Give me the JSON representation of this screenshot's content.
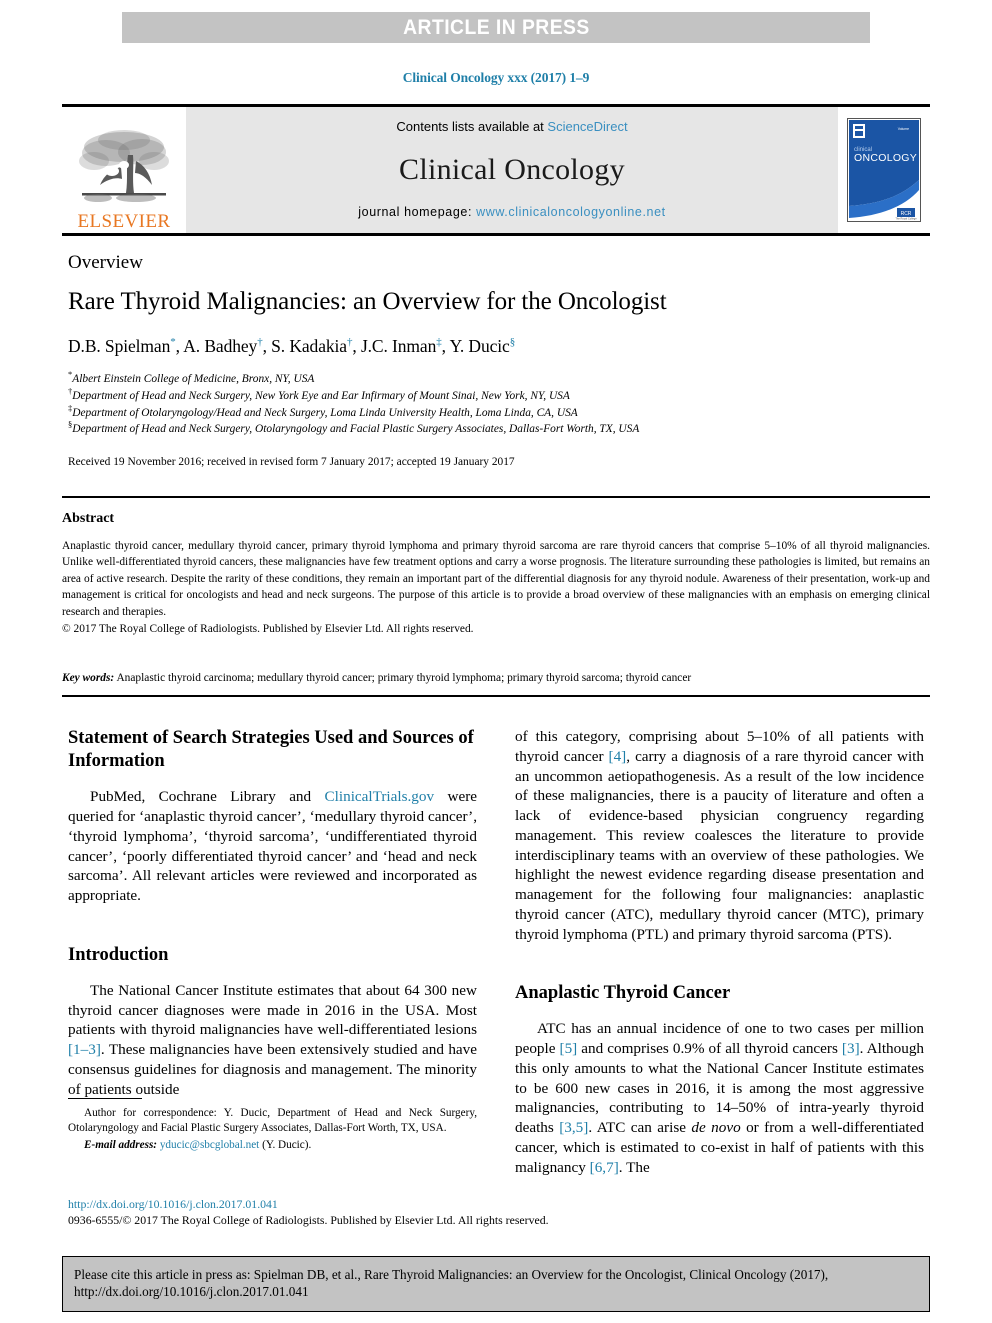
{
  "banner": {
    "label": "ARTICLE IN PRESS"
  },
  "journal_running_head": "Clinical Oncology xxx (2017) 1–9",
  "masthead": {
    "publisher_name": "ELSEVIER",
    "contents_prefix": "Contents lists available at ",
    "contents_link": "ScienceDirect",
    "journal_title": "Clinical Oncology",
    "homepage_prefix": "journal homepage: ",
    "homepage_url": "www.clinicaloncologyonline.net",
    "cover": {
      "line1": "clinical",
      "line2": "ONCOLOGY",
      "badge": "RCR"
    }
  },
  "article": {
    "doctype": "Overview",
    "title": "Rare Thyroid Malignancies: an Overview for the Oncologist",
    "authors": "D.B. Spielman *, A. Badhey †, S. Kadakia †, J.C. Inman ‡, Y. Ducic §",
    "author_list": [
      {
        "name": "D.B. Spielman",
        "marker": "*"
      },
      {
        "name": "A. Badhey",
        "marker": "†"
      },
      {
        "name": "S. Kadakia",
        "marker": "†"
      },
      {
        "name": "J.C. Inman",
        "marker": "‡"
      },
      {
        "name": "Y. Ducic",
        "marker": "§"
      }
    ],
    "affiliations": [
      {
        "marker": "*",
        "text": "Albert Einstein College of Medicine, Bronx, NY, USA"
      },
      {
        "marker": "†",
        "text": "Department of Head and Neck Surgery, New York Eye and Ear Infirmary of Mount Sinai, New York, NY, USA"
      },
      {
        "marker": "‡",
        "text": "Department of Otolaryngology/Head and Neck Surgery, Loma Linda University Health, Loma Linda, CA, USA"
      },
      {
        "marker": "§",
        "text": "Department of Head and Neck Surgery, Otolaryngology and Facial Plastic Surgery Associates, Dallas-Fort Worth, TX, USA"
      }
    ],
    "history": "Received 19 November 2016; received in revised form 7 January 2017; accepted 19 January 2017"
  },
  "abstract": {
    "heading": "Abstract",
    "body": "Anaplastic thyroid cancer, medullary thyroid cancer, primary thyroid lymphoma and primary thyroid sarcoma are rare thyroid cancers that comprise 5–10% of all thyroid malignancies. Unlike well-differentiated thyroid cancers, these malignancies have few treatment options and carry a worse prognosis. The literature surrounding these pathologies is limited, but remains an area of active research. Despite the rarity of these conditions, they remain an important part of the differential diagnosis for any thyroid nodule. Awareness of their presentation, work-up and management is critical for oncologists and head and neck surgeons. The purpose of this article is to provide a broad overview of these malignancies with an emphasis on emerging clinical research and therapies.",
    "copyright": "© 2017 The Royal College of Radiologists. Published by Elsevier Ltd. All rights reserved.",
    "keywords_label": "Key words:",
    "keywords": "Anaplastic thyroid carcinoma; medullary thyroid cancer; primary thyroid lymphoma; primary thyroid sarcoma; thyroid cancer"
  },
  "sections": {
    "search_strategies": {
      "heading": "Statement of Search Strategies Used and Sources of Information",
      "para_1_a": "PubMed, Cochrane Library and ",
      "para_1_link": "ClinicalTrials.gov",
      "para_1_b": " were queried for ‘anaplastic thyroid cancer’, ‘medullary thyroid cancer’, ‘thyroid lymphoma’, ‘thyroid sarcoma’, ‘undifferentiated thyroid cancer’, ‘poorly differentiated thyroid cancer’ and ‘head and neck sarcoma’. All relevant articles were reviewed and incorporated as appropriate."
    },
    "introduction": {
      "heading": "Introduction",
      "para_1_a": "The National Cancer Institute estimates that about 64 300 new thyroid cancer diagnoses were made in 2016 in the USA. Most patients with thyroid malignancies have well-differentiated lesions ",
      "para_1_ref": "[1–3]",
      "para_1_b": ". These malignancies have been extensively studied and have consensus guidelines for diagnosis and management. The minority of patients outside",
      "para_2_a": "of this category, comprising about 5–10% of all patients with thyroid cancer ",
      "para_2_ref": "[4]",
      "para_2_b": ", carry a diagnosis of a rare thyroid cancer with an uncommon aetiopathogenesis. As a result of the low incidence of these malignancies, there is a paucity of literature and often a lack of evidence-based physician congruency regarding management. This review coalesces the literature to provide interdisciplinary teams with an overview of these pathologies. We highlight the newest evidence regarding disease presentation and management for the following four malignancies: anaplastic thyroid cancer (ATC), medullary thyroid cancer (MTC), primary thyroid lymphoma (PTL) and primary thyroid sarcoma (PTS)."
    },
    "atc": {
      "heading": "Anaplastic Thyroid Cancer",
      "p_a": "ATC has an annual incidence of one to two cases per million people ",
      "p_ref1": "[5]",
      "p_b": " and comprises 0.9% of all thyroid cancers ",
      "p_ref2": "[3]",
      "p_c": ". Although this only amounts to what the National Cancer Institute estimates to be 600 new cases in 2016, it is among the most aggressive malignancies, contributing to 14–50% of intra-yearly thyroid deaths ",
      "p_ref3": "[3,5]",
      "p_d": ". ATC can arise ",
      "p_italic": "de novo",
      "p_e": " or from a well-differentiated cancer, which is estimated to co-exist in half of patients with this malignancy ",
      "p_ref4": "[6,7]",
      "p_f": ". The"
    }
  },
  "footnote": {
    "correspondence": "Author for correspondence: Y. Ducic, Department of Head and Neck Surgery, Otolaryngology and Facial Plastic Surgery Associates, Dallas-Fort Worth, TX, USA.",
    "email_label": "E-mail address:",
    "email": "yducic@sbcglobal.net",
    "email_suffix": "(Y. Ducic)."
  },
  "doi_block": {
    "doi_url": "http://dx.doi.org/10.1016/j.clon.2017.01.041",
    "copyright": "0936-6555/© 2017 The Royal College of Radiologists. Published by Elsevier Ltd. All rights reserved."
  },
  "cite_box": {
    "text": "Please cite this article in press as: Spielman DB, et al., Rare Thyroid Malignancies: an Overview for the Oncologist, Clinical Oncology (2017), http://dx.doi.org/10.1016/j.clon.2017.01.041"
  },
  "colors": {
    "link_blue": "#1f7fa8",
    "sciencedirect_blue": "#3a8fc0",
    "elsevier_orange": "#e87722",
    "banner_gray": "#c3c3c3",
    "masthead_gray": "#e6e6e6",
    "cover_blue": "#1b55a5"
  }
}
